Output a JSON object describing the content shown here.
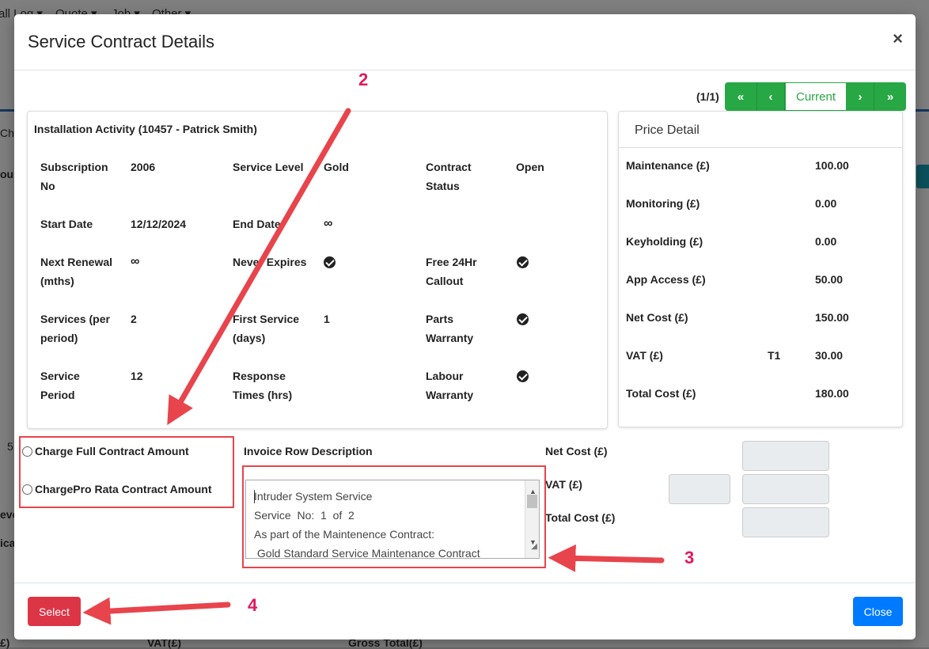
{
  "background": {
    "nav": [
      "all Log ▾",
      "Quote ▾",
      "Job ▾",
      "Other ▾"
    ],
    "frags": [
      "Cha",
      "our",
      "5",
      "eve",
      "ica",
      "£)",
      "VAT(£)",
      "Gross Total(£)"
    ]
  },
  "modal": {
    "title": "Service Contract Details",
    "close_glyph": "×",
    "pager": {
      "count": "(1/1)",
      "first": "«",
      "prev": "‹",
      "current": "Current",
      "next": "›",
      "last": "»"
    },
    "info": {
      "title": "Installation Activity (10457 - Patrick Smith)",
      "subscription_label_1": "Subscription",
      "subscription_label_2": "No",
      "subscription_value": "2006",
      "service_level_label": "Service Level",
      "service_level_value": "Gold",
      "contract_status_label_1": "Contract",
      "contract_status_label_2": "Status",
      "contract_status_value": "Open",
      "start_date_label": "Start Date",
      "start_date_value": "12/12/2024",
      "end_date_label": "End Date",
      "end_date_value": "∞",
      "next_renewal_label_1": "Next Renewal",
      "next_renewal_label_2": "(mths)",
      "next_renewal_value": "∞",
      "never_expires_label": "Never Expires",
      "free_callout_label_1": "Free 24Hr",
      "free_callout_label_2": "Callout",
      "services_label_1": "Services (per",
      "services_label_2": "period)",
      "services_value": "2",
      "first_service_label_1": "First Service",
      "first_service_label_2": "(days)",
      "first_service_value": "1",
      "parts_warranty_label_1": "Parts",
      "parts_warranty_label_2": "Warranty",
      "service_period_label_1": "Service",
      "service_period_label_2": "Period",
      "service_period_value": "12",
      "response_times_label_1": "Response",
      "response_times_label_2": "Times (hrs)",
      "labour_warranty_label_1": "Labour",
      "labour_warranty_label_2": "Warranty"
    },
    "price": {
      "title": "Price Detail",
      "rows": [
        {
          "label": "Maintenance (£)",
          "code": "",
          "value": "100.00"
        },
        {
          "label": "Monitoring (£)",
          "code": "",
          "value": "0.00"
        },
        {
          "label": "Keyholding (£)",
          "code": "",
          "value": "0.00"
        },
        {
          "label": "App Access (£)",
          "code": "",
          "value": "50.00"
        },
        {
          "label": "Net Cost (£)",
          "code": "",
          "value": "150.00"
        },
        {
          "label": "VAT (£)",
          "code": "T1",
          "value": "30.00"
        },
        {
          "label": "Total Cost (£)",
          "code": "",
          "value": "180.00"
        }
      ]
    },
    "options": {
      "full": "Charge Full Contract Amount",
      "prorata": "ChargePro Rata Contract Amount"
    },
    "invoice": {
      "label": "Invoice Row Description",
      "lines": "Intruder System Service\nService  No:  1  of  2\nAs part of the Maintenence Contract:\n Gold Standard Service Maintenance Contract"
    },
    "costs": {
      "net_label": "Net Cost (£)",
      "vat_label": "VAT (£)",
      "total_label": "Total Cost (£)"
    },
    "footer": {
      "select": "Select",
      "close": "Close"
    }
  },
  "annotations": {
    "n2": "2",
    "n3": "3",
    "n4": "4"
  },
  "colors": {
    "green": "#28a745",
    "red": "#dc3545",
    "blue": "#007bff",
    "annotation": "#e8444c"
  }
}
